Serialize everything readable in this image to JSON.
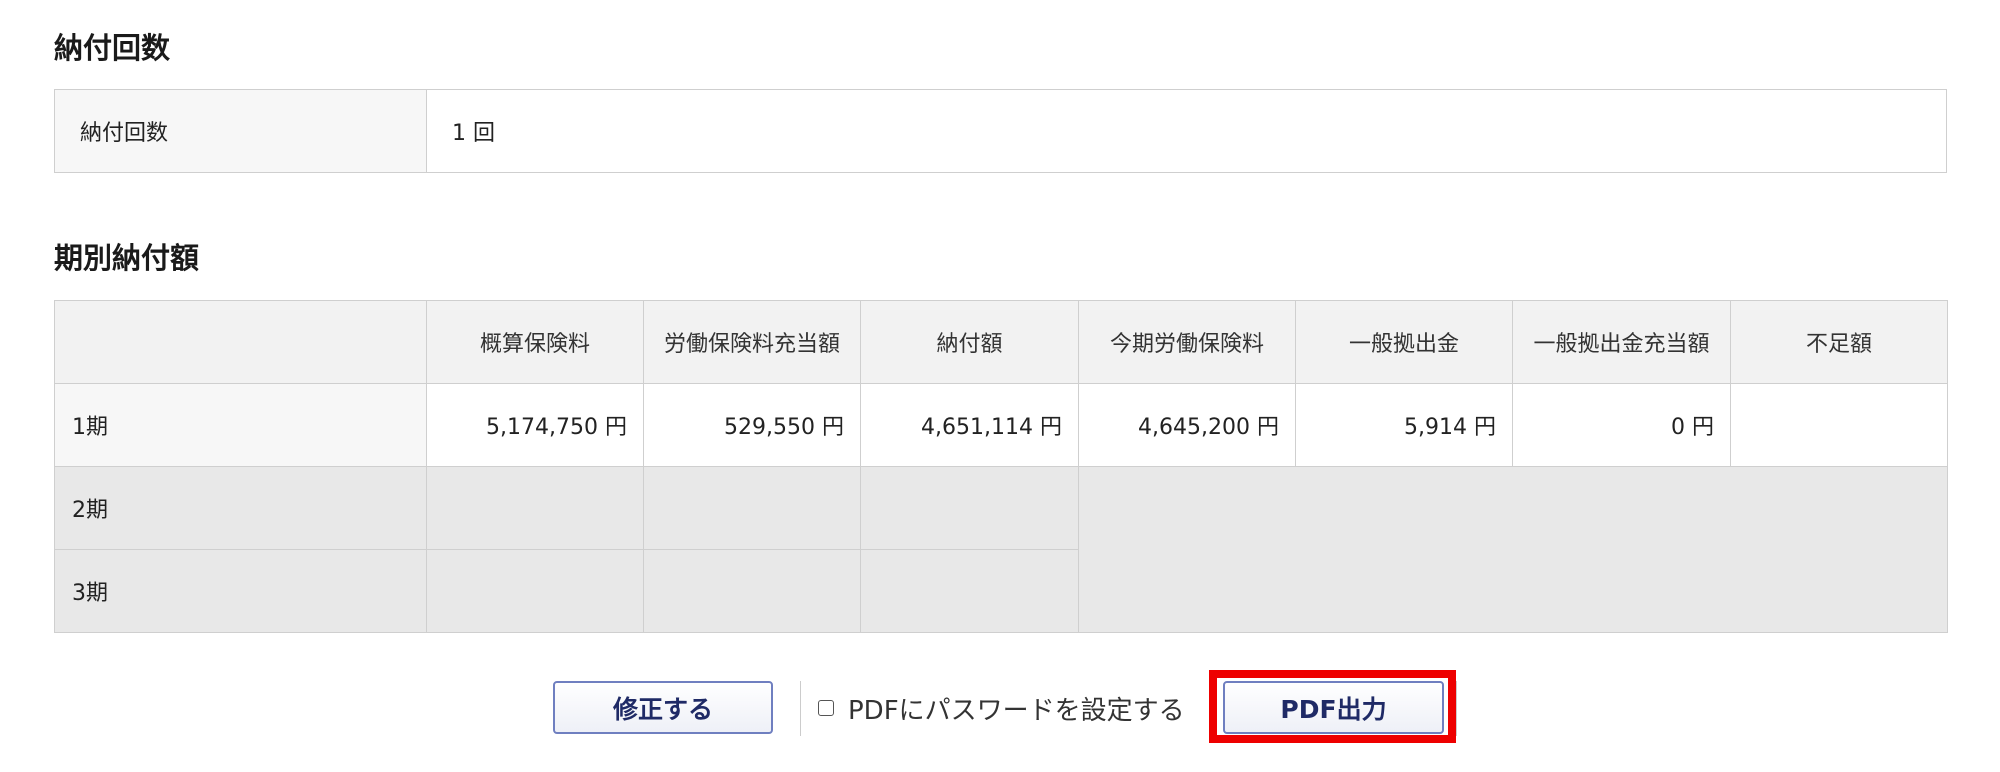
{
  "count_section": {
    "title": "納付回数",
    "row_label": "納付回数",
    "row_value": "1 回"
  },
  "period_section": {
    "title": "期別納付額",
    "headers": [
      "",
      "概算保険料",
      "労働保険料充当額",
      "納付額",
      "今期労働保険料",
      "一般拠出金",
      "一般拠出金充当額",
      "不足額"
    ],
    "rows": [
      {
        "label": "1期",
        "cells": [
          "5,174,750 円",
          "529,550 円",
          "4,651,114 円",
          "4,645,200 円",
          "5,914 円",
          "0 円",
          ""
        ]
      },
      {
        "label": "2期",
        "cells": [
          "",
          "",
          ""
        ]
      },
      {
        "label": "3期",
        "cells": [
          "",
          "",
          ""
        ]
      }
    ]
  },
  "actions": {
    "edit_label": "修正する",
    "pdf_password_label": "PDFにパスワードを設定する",
    "pdf_password_checked": false,
    "pdf_output_label": "PDF出力"
  },
  "colors": {
    "highlight": "#ee0000",
    "button_text": "#1f2a66",
    "button_border": "#6f7fc0",
    "disabled_cell": "#e8e8e8"
  }
}
